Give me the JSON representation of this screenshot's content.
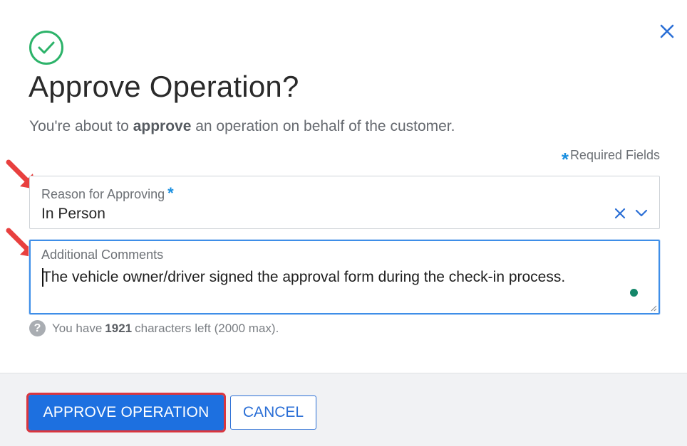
{
  "dialog": {
    "title": "Approve Operation?",
    "subtitle_prefix": "You're about to ",
    "subtitle_bold": "approve",
    "subtitle_suffix": " an operation on behalf of the customer.",
    "required_note": "Required Fields",
    "required_marker": "*",
    "close_icon": "close-icon",
    "status_icon": "check-circle-icon"
  },
  "reason_field": {
    "label": "Reason for Approving",
    "required_marker": "*",
    "value": "In Person"
  },
  "comments_field": {
    "label": "Additional Comments",
    "value": "The vehicle owner/driver signed the approval form during the check-in process."
  },
  "helper": {
    "icon": "?",
    "prefix": "You have",
    "count": "1921",
    "suffix": "characters left (2000 max)."
  },
  "footer": {
    "approve_label": "APPROVE OPERATION",
    "cancel_label": "CANCEL"
  },
  "colors": {
    "accent": "#1d70e0",
    "success": "#2db36a",
    "required": "#1a8fe0",
    "annotation": "#e8403f"
  }
}
